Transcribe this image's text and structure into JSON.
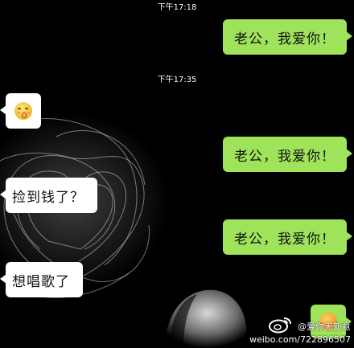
{
  "chat": {
    "timestamps": [
      "下午17:18",
      "下午17:35"
    ],
    "messages": [
      {
        "side": "out",
        "text": "老公，我爱你！"
      },
      {
        "side": "in",
        "emoji": "kissing-face-icon"
      },
      {
        "side": "out",
        "text": "老公，我爱你！"
      },
      {
        "side": "in",
        "text": "捡到钱了？"
      },
      {
        "side": "out",
        "text": "老公，我爱你！"
      },
      {
        "side": "in",
        "text": "想唱歌了"
      },
      {
        "side": "out",
        "emoji": "emoji-face-icon"
      }
    ]
  },
  "watermark": {
    "handle": "@爱你无新意",
    "url": "weibo.com/722896507"
  },
  "colors": {
    "outgoing_bubble": "#9ee35a",
    "incoming_bubble": "#ffffff",
    "background": "#000000"
  }
}
